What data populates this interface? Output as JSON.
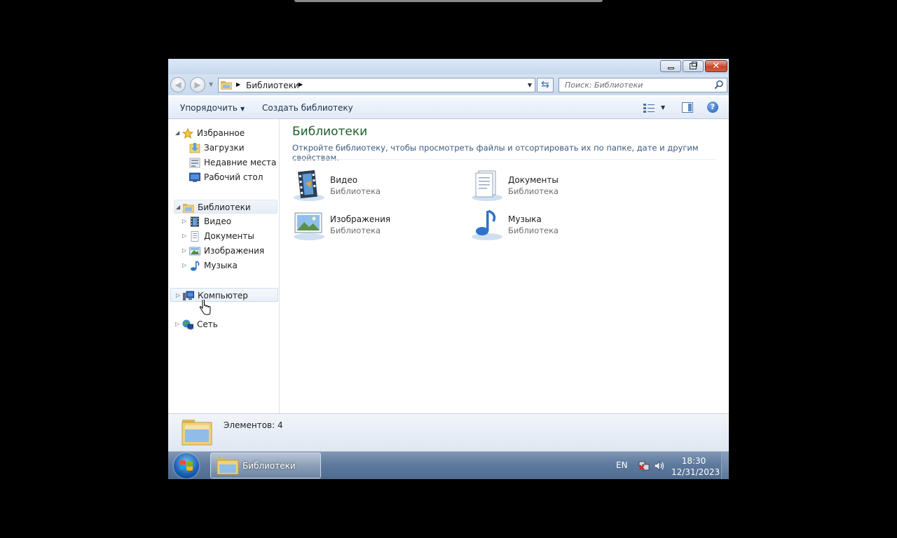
{
  "window": {
    "caption_buttons": [
      "minimize-icon",
      "restore-icon",
      "close-icon"
    ]
  },
  "nav": {
    "back_icon": "back-arrow-icon",
    "forward_icon": "forward-arrow-icon",
    "address_path": "Библиотеки",
    "search_placeholder": "Поиск: Библиотеки"
  },
  "toolbar": {
    "organize_label": "Упорядочить",
    "new_library_label": "Создать библиотеку"
  },
  "navpane": {
    "favorites": {
      "label": "Избранное",
      "items": [
        {
          "label": "Загрузки"
        },
        {
          "label": "Недавние места"
        },
        {
          "label": "Рабочий стол"
        }
      ]
    },
    "libraries": {
      "label": "Библиотеки",
      "items": [
        {
          "label": "Видео"
        },
        {
          "label": "Документы"
        },
        {
          "label": "Изображения"
        },
        {
          "label": "Музыка"
        }
      ]
    },
    "computer": {
      "label": "Компьютер"
    },
    "network": {
      "label": "Сеть"
    }
  },
  "content": {
    "title": "Библиотеки",
    "description": "Откройте библиотеку, чтобы просмотреть файлы и отсортировать их по папке, дате и другим свойствам.",
    "libraries": [
      {
        "name": "Видео",
        "type": "Библиотека",
        "icon": "video-library-icon"
      },
      {
        "name": "Документы",
        "type": "Библиотека",
        "icon": "documents-library-icon"
      },
      {
        "name": "Изображения",
        "type": "Библиотека",
        "icon": "pictures-library-icon"
      },
      {
        "name": "Музыка",
        "type": "Библиотека",
        "icon": "music-library-icon"
      }
    ]
  },
  "details": {
    "count_text": "Элементов: 4"
  },
  "taskbar": {
    "window_label": "Библиотеки",
    "language": "EN",
    "time": "18:30",
    "date": "12/31/2023"
  },
  "colors": {
    "title_green": "#1e5e2a",
    "link_blue": "#3b5a7d",
    "taskbar_blue": "#5e7a9d"
  }
}
